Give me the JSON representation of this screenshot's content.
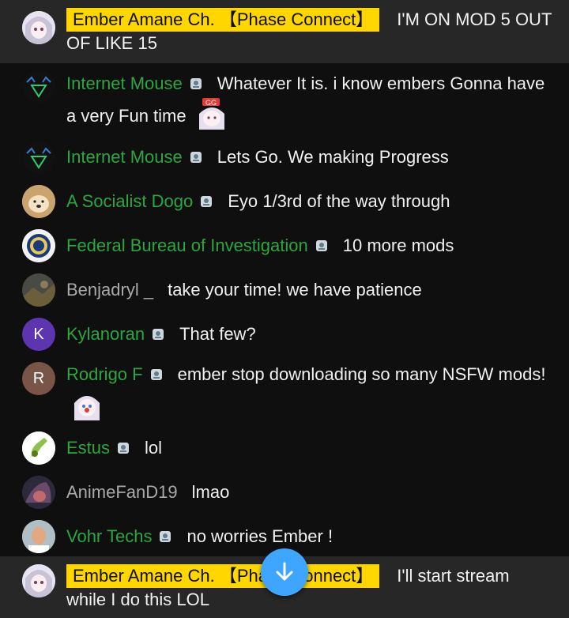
{
  "messages": [
    {
      "author": "Ember Amane Ch. 【Phase Connect】",
      "text": "I'M ON MOD 5 OUT OF LIKE 15",
      "owner": true
    },
    {
      "author": "Internet Mouse",
      "text": "Whatever It is. i know embers Gonna have a very Fun time",
      "emote": "gg-emote-icon"
    },
    {
      "author": "Internet Mouse",
      "text": "Lets Go. We making Progress"
    },
    {
      "author": "A Socialist Dogo",
      "text": "Eyo 1/3rd of the way through"
    },
    {
      "author": "Federal Bureau of Investigation",
      "text": "10 more mods"
    },
    {
      "author": "Benjadryl _",
      "text": "take your time! we have patience"
    },
    {
      "author": "Kylanoran",
      "text": "That few?",
      "avatar_letter": "K",
      "avatar_color": "#5e35b1"
    },
    {
      "author": "Rodrigo F",
      "text": "ember stop downloading so many NSFW mods!",
      "avatar_letter": "R",
      "avatar_color": "#795548",
      "emote": "clown-emote-icon"
    },
    {
      "author": "Estus",
      "text": "lol"
    },
    {
      "author": "AnimeFanD19",
      "text": "lmao"
    },
    {
      "author": "Vohr Techs",
      "text": "no worries Ember !"
    },
    {
      "author": "Ember Amane Ch. 【Phase Connect】",
      "text": "I'll start stream while I do this LOL",
      "owner": true
    }
  ],
  "colors": {
    "member_name": "#2ba640",
    "owner_badge": "#ffd600",
    "accent": "#3ea6ff"
  },
  "scroll_button_icon": "arrow-down-icon"
}
